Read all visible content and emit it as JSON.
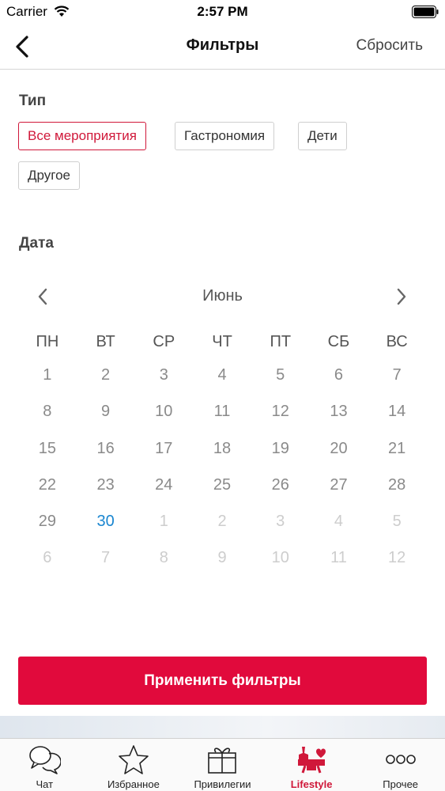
{
  "status": {
    "carrier": "Carrier",
    "time": "2:57 PM"
  },
  "nav": {
    "title": "Фильтры",
    "reset_label": "Сбросить"
  },
  "type_section": {
    "title": "Тип",
    "chips": [
      {
        "label": "Все мероприятия",
        "selected": true
      },
      {
        "label": "Гастрономия",
        "selected": false
      },
      {
        "label": "Дети",
        "selected": false
      },
      {
        "label": "Другое",
        "selected": false
      }
    ]
  },
  "date_section": {
    "title": "Дата",
    "month": "Июнь",
    "weekdays": [
      "ПН",
      "ВТ",
      "СР",
      "ЧТ",
      "ПТ",
      "СБ",
      "ВС"
    ],
    "weeks": [
      [
        "1",
        "2",
        "3",
        "4",
        "5",
        "6",
        "7"
      ],
      [
        "8",
        "9",
        "10",
        "11",
        "12",
        "13",
        "14"
      ],
      [
        "15",
        "16",
        "17",
        "18",
        "19",
        "20",
        "21"
      ],
      [
        "22",
        "23",
        "24",
        "25",
        "26",
        "27",
        "28"
      ],
      [
        "29",
        "30",
        "1",
        "2",
        "3",
        "4",
        "5"
      ],
      [
        "6",
        "7",
        "8",
        "9",
        "10",
        "11",
        "12"
      ]
    ],
    "today_label": "30",
    "accent_today": "#1a86d0"
  },
  "apply_button": {
    "label": "Применить фильтры",
    "color": "#e10a3c"
  },
  "tabbar": {
    "items": [
      {
        "label": "Чат",
        "icon": "chat-icon",
        "active": false
      },
      {
        "label": "Избранное",
        "icon": "star-icon",
        "active": false
      },
      {
        "label": "Привилегии",
        "icon": "gift-icon",
        "active": false
      },
      {
        "label": "Lifestyle",
        "icon": "lifestyle-icon",
        "active": true
      },
      {
        "label": "Прочее",
        "icon": "more-icon",
        "active": false
      }
    ],
    "active_color": "#d0183a"
  }
}
